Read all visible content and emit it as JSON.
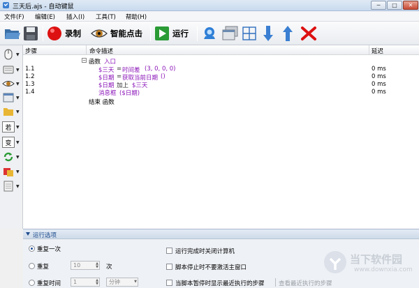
{
  "window": {
    "title": "三天后.ajs - 自动键鼠",
    "min": "─",
    "max": "□",
    "close": "✕"
  },
  "menu": [
    "文件(F)",
    "编辑(E)",
    "插入(I)",
    "工具(T)",
    "帮助(H)"
  ],
  "toolbar": {
    "record": "录制",
    "smart_click": "智能点击",
    "run": "运行"
  },
  "grid": {
    "headers": {
      "step": "步骤",
      "description": "命令描述",
      "delay": "延迟"
    },
    "func_keyword": "函数",
    "func_name": "入口",
    "rows": [
      {
        "step": "1.1",
        "var": "$三天",
        "op": "=",
        "call": "时间差",
        "args": "(3, 0, 0, 0)",
        "delay": "0 ms"
      },
      {
        "step": "1.2",
        "var": "$日期",
        "op": "=",
        "call": "获取当前日期",
        "args": "()",
        "delay": "0 ms"
      },
      {
        "step": "1.3",
        "var": "$日期",
        "op": "加上",
        "call": "$三天",
        "args": "",
        "delay": "0 ms"
      },
      {
        "step": "1.4",
        "var": "",
        "op": "",
        "call": "消息框",
        "args": "($日期)",
        "delay": "0 ms"
      }
    ],
    "end_text": "结束 函数"
  },
  "leftbar": {
    "if_label": "若",
    "var_label": "变"
  },
  "options": {
    "header": "运行选项",
    "repeat_once": "重复一次",
    "repeat": "重复",
    "repeat_count": "10",
    "times": "次",
    "repeat_time": "重复时间",
    "repeat_minutes": "1",
    "unit": "分钟",
    "cb_shutdown": "运行完成时关闭计算机",
    "cb_no_activate": "脚本停止时不要激活主窗口",
    "cb_show_recent": "当脚本暂停时显示最近执行的步骤",
    "view_recent": "查看最近执行的步骤"
  },
  "watermark": {
    "cn": "当下软件园",
    "en": "www.downxia.com"
  },
  "colors": {
    "purple": "#8a13b8",
    "accent": "#1c4a8c"
  }
}
